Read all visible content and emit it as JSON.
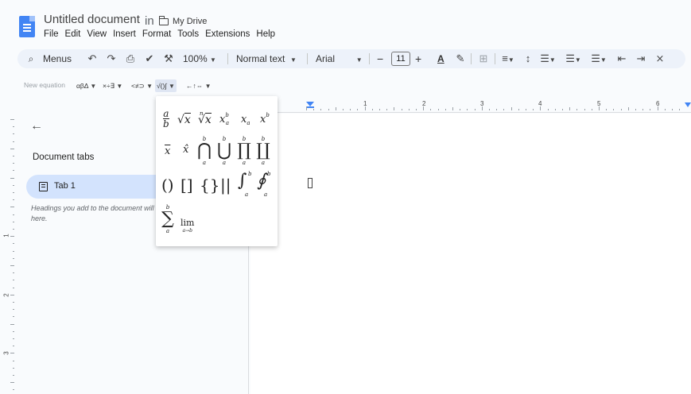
{
  "header": {
    "title": "Untitled document",
    "in_label": "in",
    "folder": "My Drive",
    "menus": [
      "File",
      "Edit",
      "View",
      "Insert",
      "Format",
      "Tools",
      "Extensions",
      "Help"
    ]
  },
  "toolbar": {
    "menus_label": "Menus",
    "zoom": "100%",
    "style": "Normal text",
    "font": "Arial",
    "font_size": "11",
    "minus": "−",
    "plus": "+",
    "text_color_letter": "A"
  },
  "equation_toolbar": {
    "label": "New equation",
    "buttons": [
      "αβΔ",
      "×÷∃",
      "<≠⊃",
      "√()∫",
      "←↑⇔"
    ]
  },
  "ruler": {
    "h_numbers": [
      "1",
      "2",
      "3",
      "4",
      "5",
      "6"
    ],
    "v_numbers": [
      "1",
      "2",
      "3"
    ]
  },
  "sidebar": {
    "heading": "Document tabs",
    "tab_label": "Tab 1",
    "hint": "Headings you add to the document will appear here."
  },
  "equation_panel": {
    "row1": [
      "a/b",
      "√x",
      "ⁿ√x",
      "x_a^b",
      "x_a",
      "x^b"
    ],
    "row2": [
      "x̄",
      "x̂",
      "⋂",
      "⋃",
      "∏",
      "∐"
    ],
    "row3": [
      "()",
      "[]",
      "{}",
      "||",
      "∫",
      "∮"
    ],
    "row4": [
      "∑",
      "lim"
    ],
    "vars": {
      "a": "a",
      "b": "b",
      "x": "x",
      "n": "n",
      "lim_sub": "a→b"
    }
  },
  "colors": {
    "accent": "#4285f4",
    "toolbar_bg": "#edf2fa",
    "tab_selected_bg": "#d3e3fd"
  }
}
